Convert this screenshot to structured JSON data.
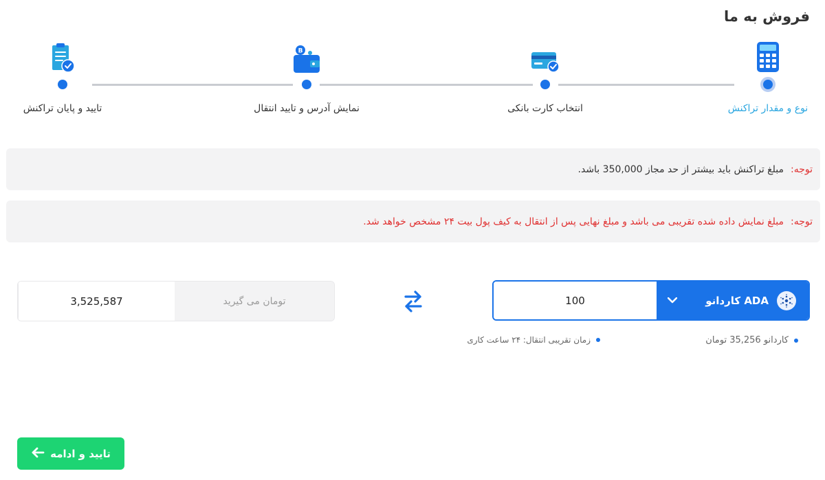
{
  "page": {
    "title": "فروش به ما"
  },
  "stepper": {
    "steps": [
      {
        "label": "نوع و مقدار تراکنش",
        "icon": "calculator-icon",
        "active": true
      },
      {
        "label": "انتخاب کارت بانکی",
        "icon": "bank-card-icon",
        "active": false
      },
      {
        "label": "نمایش آدرس و تایید انتقال",
        "icon": "wallet-icon",
        "active": false
      },
      {
        "label": "تایید و پایان تراکنش",
        "icon": "clipboard-check-icon",
        "active": false
      }
    ]
  },
  "notices": [
    {
      "key": "توجه:",
      "text": "مبلغ تراکنش باید بیشتر از حد مجاز 350,000 باشد."
    },
    {
      "key": "توجه:",
      "text": "مبلغ نمایش داده شده تقریبی می باشد و مبلغ نهایی پس از انتقال به کیف پول بیت ۲۴ مشخص خواهد شد."
    }
  ],
  "converter": {
    "send_amount": "100",
    "coin_label": "ADA کاردانو",
    "coin_icon": "cardano-logo-icon",
    "receive_amount": "3,525,587",
    "receive_label": "تومان می گیرید",
    "swap_icon": "swap-arrows-icon",
    "rate_text": "کاردانو 35,256 تومان",
    "transfer_time_text": "زمان تقریبی انتقال: ۲۴ ساعت کاری"
  },
  "actions": {
    "continue_label": "تایید و ادامه"
  },
  "colors": {
    "accent": "#1a73e8",
    "success": "#1dd473",
    "warning_text": "#e03131",
    "active_step": "#2aa6e0"
  }
}
